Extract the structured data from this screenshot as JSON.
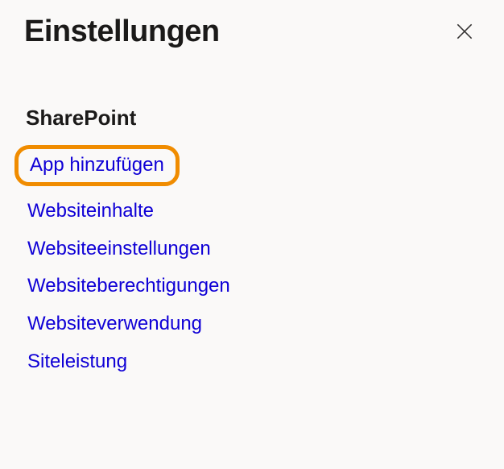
{
  "header": {
    "title": "Einstellungen",
    "close_icon": "close"
  },
  "section": {
    "title": "SharePoint",
    "links": [
      {
        "label": "App hinzufügen",
        "highlighted": true
      },
      {
        "label": "Websiteinhalte",
        "highlighted": false
      },
      {
        "label": "Websiteeinstellungen",
        "highlighted": false
      },
      {
        "label": "Websiteberechtigungen",
        "highlighted": false
      },
      {
        "label": "Websiteverwendung",
        "highlighted": false
      },
      {
        "label": "Siteleistung",
        "highlighted": false
      }
    ]
  }
}
